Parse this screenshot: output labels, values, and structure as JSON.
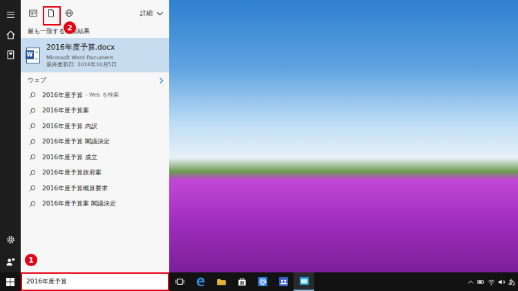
{
  "search_panel": {
    "details_menu": "詳細",
    "best_match": {
      "heading": "最も一致する検索結果",
      "icon_letter": "W",
      "title": "2016年度予算.docx",
      "type": "Microsoft Word Document",
      "modified": "最終更新日: 2016年10月5日",
      "selected": true
    },
    "web_heading": "ウェブ",
    "suggestions": [
      {
        "text": "2016年度予算",
        "hint": "- Web を検索"
      },
      {
        "text": "2016年度予算案",
        "hint": ""
      },
      {
        "text": "2016年度予算 内訳",
        "hint": ""
      },
      {
        "text": "2016年度予算 閣議決定",
        "hint": ""
      },
      {
        "text": "2016年度予算 成立",
        "hint": ""
      },
      {
        "text": "2016年度予算政府案",
        "hint": ""
      },
      {
        "text": "2016年度予算概算要求",
        "hint": ""
      },
      {
        "text": "2016年度予算案 閣議決定",
        "hint": ""
      }
    ]
  },
  "taskbar": {
    "search_box": {
      "value": "2016年度予算"
    },
    "ime": "あ"
  },
  "annotations": [
    {
      "number": "1",
      "target": "search-box"
    },
    {
      "number": "2",
      "target": "documents-filter"
    }
  ]
}
